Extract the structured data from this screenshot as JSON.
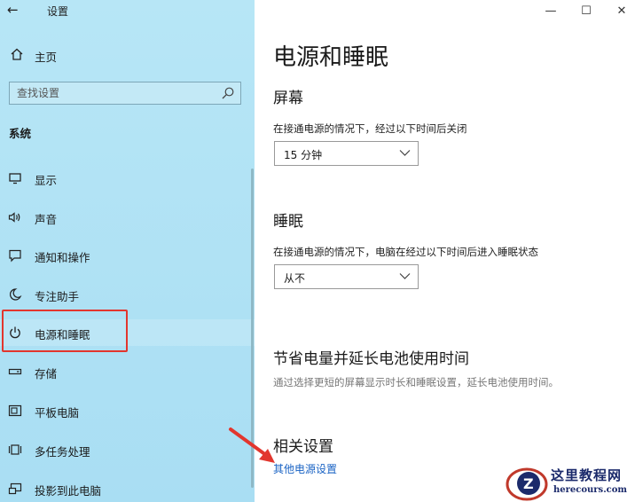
{
  "window": {
    "back_icon": "back-arrow-icon",
    "title": "设置",
    "minimize": "—",
    "maximize": "☐",
    "close": "✕"
  },
  "sidebar": {
    "home_label": "主页",
    "search_placeholder": "查找设置",
    "section_title": "系统",
    "items": [
      {
        "label": "显示",
        "icon": "display-icon"
      },
      {
        "label": "声音",
        "icon": "speaker-icon"
      },
      {
        "label": "通知和操作",
        "icon": "notification-icon"
      },
      {
        "label": "专注助手",
        "icon": "moon-icon"
      },
      {
        "label": "电源和睡眠",
        "icon": "power-icon",
        "selected": true
      },
      {
        "label": "存储",
        "icon": "storage-icon"
      },
      {
        "label": "平板电脑",
        "icon": "tablet-icon"
      },
      {
        "label": "多任务处理",
        "icon": "multitask-icon"
      },
      {
        "label": "投影到此电脑",
        "icon": "project-icon"
      }
    ]
  },
  "main": {
    "page_title": "电源和睡眠",
    "screen": {
      "heading": "屏幕",
      "caption": "在接通电源的情况下，经过以下时间后关闭",
      "value": "15 分钟"
    },
    "sleep": {
      "heading": "睡眠",
      "caption": "在接通电源的情况下，电脑在经过以下时间后进入睡眠状态",
      "value": "从不"
    },
    "battery": {
      "heading": "节省电量并延长电池使用时间",
      "caption": "通过选择更短的屏幕显示时长和睡眠设置，延长电池使用时间。"
    },
    "related": {
      "heading": "相关设置",
      "link": "其他电源设置"
    }
  },
  "watermark": {
    "cn": "这里教程网",
    "en": "herecours.com"
  },
  "colors": {
    "sidebar_bg": "#b7e6f6",
    "highlight": "#e2362e",
    "link": "#1a63c4",
    "arrow": "#e2362e"
  }
}
